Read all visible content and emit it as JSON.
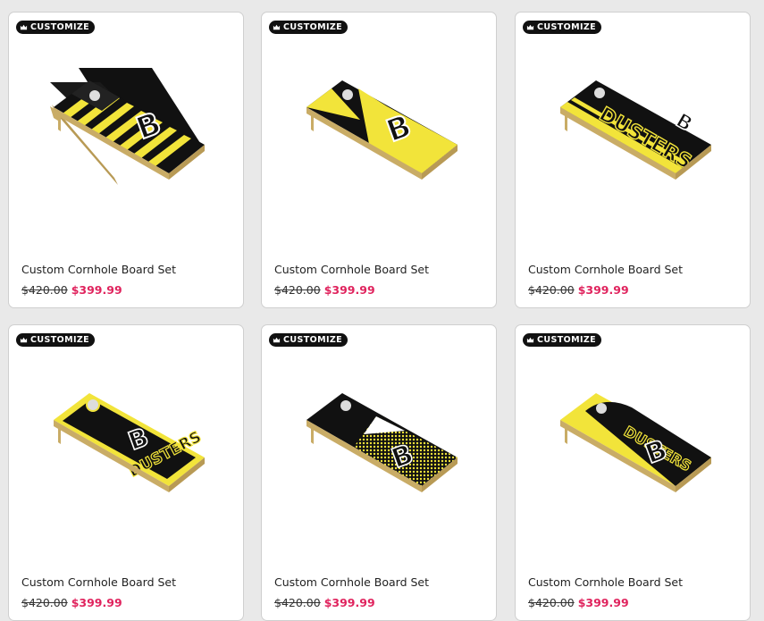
{
  "products": [
    {
      "badge": "CUSTOMIZE",
      "title": "Custom Cornhole Board Set",
      "old_price": "$420.00",
      "sale_price": "$399.99",
      "design": "flag-stripes",
      "board_text": ""
    },
    {
      "badge": "CUSTOMIZE",
      "title": "Custom Cornhole Board Set",
      "old_price": "$420.00",
      "sale_price": "$399.99",
      "design": "diagonal-split",
      "board_text": ""
    },
    {
      "badge": "CUSTOMIZE",
      "title": "Custom Cornhole Board Set",
      "old_price": "$420.00",
      "sale_price": "$399.99",
      "design": "side-stripe",
      "board_text": "DUSTERS"
    },
    {
      "badge": "CUSTOMIZE",
      "title": "Custom Cornhole Board Set",
      "old_price": "$420.00",
      "sale_price": "$399.99",
      "design": "bordered",
      "board_text": "DUSTERS"
    },
    {
      "badge": "CUSTOMIZE",
      "title": "Custom Cornhole Board Set",
      "old_price": "$420.00",
      "sale_price": "$399.99",
      "design": "halftone-chevron",
      "board_text": ""
    },
    {
      "badge": "CUSTOMIZE",
      "title": "Custom Cornhole Board Set",
      "old_price": "$420.00",
      "sale_price": "$399.99",
      "design": "yellow-arch",
      "board_text": "DUSTERS"
    }
  ],
  "colors": {
    "sale": "#e0245e",
    "board_black": "#111111",
    "board_yellow": "#f2e43a",
    "wood": "#d8c58a"
  },
  "icons": {
    "badge_icon": "crown-icon"
  }
}
